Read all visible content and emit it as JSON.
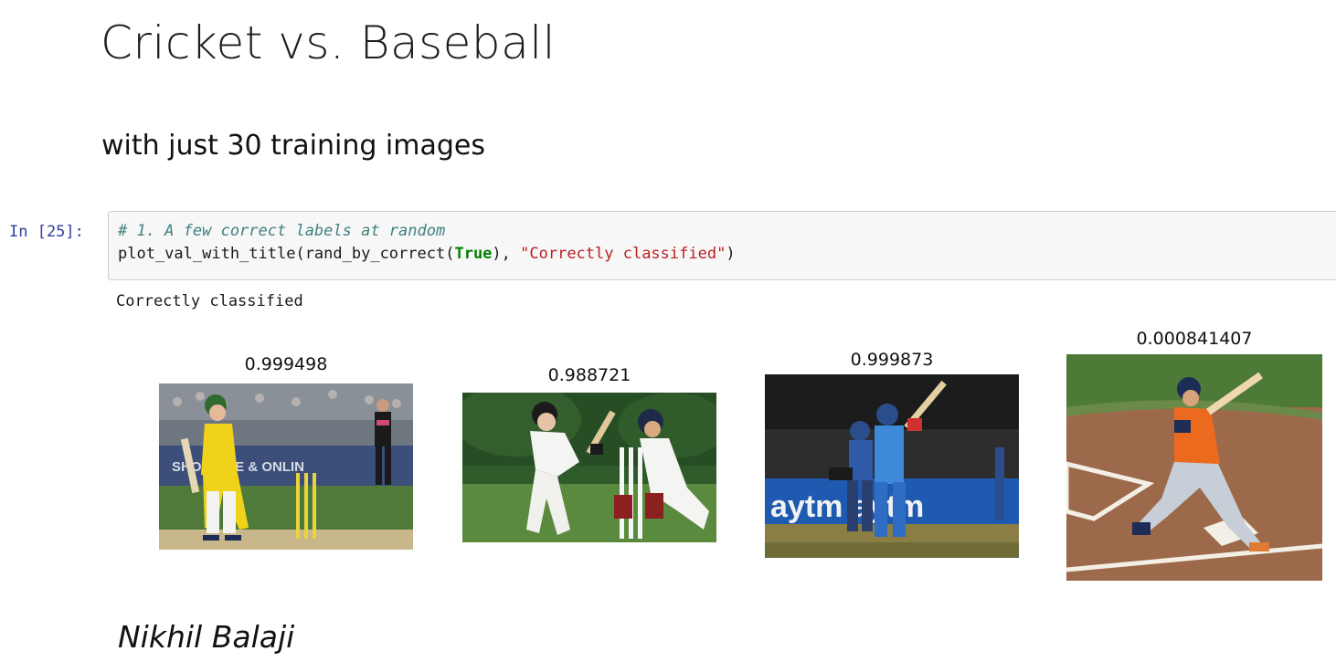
{
  "slide": {
    "title": "Cricket vs. Baseball",
    "subtitle": "with just 30 training images",
    "author": "Nikhil Balaji"
  },
  "notebook_cell": {
    "prompt": "In [25]:",
    "code_comment": "# 1. A few correct labels at random",
    "code_func": "plot_val_with_title(rand_by_correct(",
    "code_keyword": "True",
    "code_mid": "), ",
    "code_string": "\"Correctly classified\"",
    "code_end": ")",
    "output_text": "Correctly classified"
  },
  "plots": [
    {
      "label": "0.999498",
      "scene": "cricket-batter-yellow-kit"
    },
    {
      "label": "0.988721",
      "scene": "cricket-boy-batting-wicketkeeper"
    },
    {
      "label": "0.999873",
      "scene": "cricket-batter-blue-kit-night"
    },
    {
      "label": "0.000841407",
      "scene": "baseball-batter-orange-jersey"
    }
  ],
  "colors": {
    "prompt": "#303f9f",
    "comment": "#408080",
    "keyword": "#008000",
    "string": "#ba2121",
    "cell_bg": "#f7f7f7",
    "cell_border": "#cfcfcf"
  }
}
